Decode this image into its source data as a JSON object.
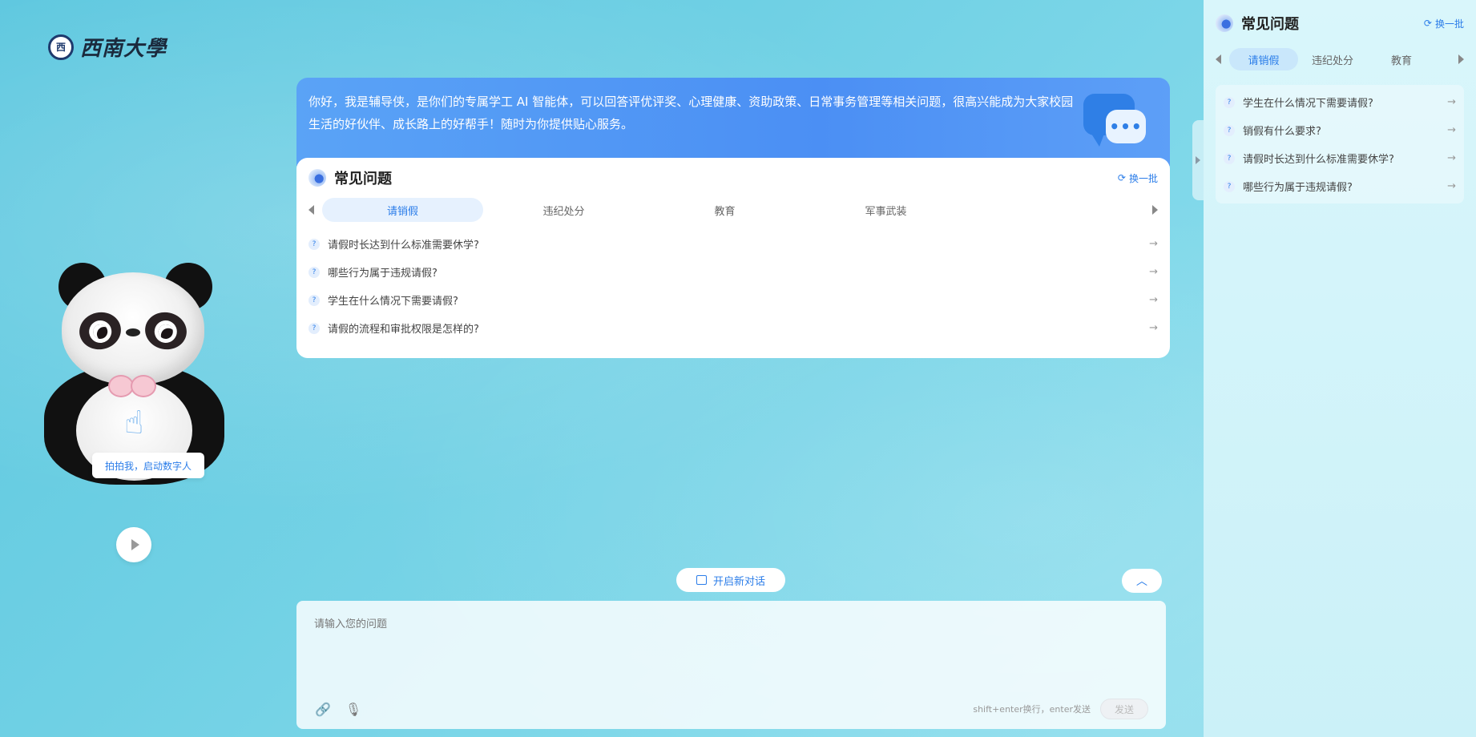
{
  "logo": {
    "seal": "西",
    "name": "西南大學"
  },
  "avatar": {
    "tip": "拍拍我，启动数字人"
  },
  "welcome": {
    "text": "你好，我是辅导侠，是你们的专属学工 AI 智能体，可以回答评优评奖、心理健康、资助政策、日常事务管理等相关问题，很高兴能成为大家校园生活的好伙伴、成长路上的好帮手！随时为你提供贴心服务。",
    "bubble_dots": "•••"
  },
  "faq": {
    "title": "常见问题",
    "refresh": "换一批",
    "tabs": [
      "请销假",
      "违纪处分",
      "教育",
      "军事武装"
    ],
    "questions": [
      "请假时长达到什么标准需要休学?",
      "哪些行为属于违规请假?",
      "学生在什么情况下需要请假?",
      "请假的流程和审批权限是怎样的?"
    ]
  },
  "new_chat": {
    "label": "开启新对话"
  },
  "input": {
    "placeholder": "请输入您的问题",
    "hint": "shift+enter换行，enter发送",
    "send": "发送"
  },
  "right_panel": {
    "title": "常见问题",
    "refresh": "换一批",
    "tabs": [
      "请销假",
      "违纪处分",
      "教育"
    ],
    "questions": [
      "学生在什么情况下需要请假?",
      "销假有什么要求?",
      "请假时长达到什么标准需要休学?",
      "哪些行为属于违规请假?"
    ]
  },
  "colors": {
    "accent": "#2b7de9",
    "banner": "#4b8ff4"
  }
}
